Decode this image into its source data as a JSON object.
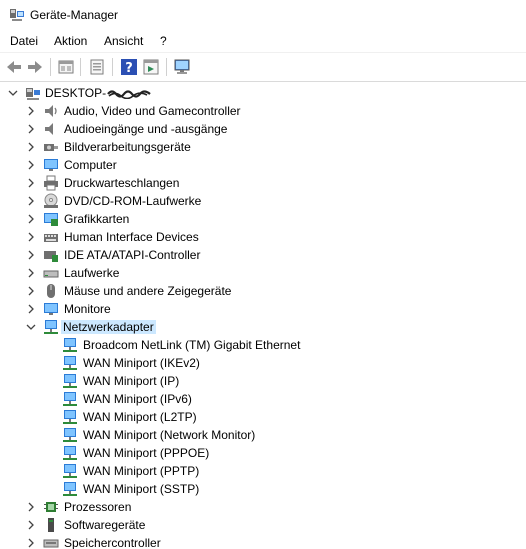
{
  "window": {
    "title": "Geräte-Manager"
  },
  "menu": [
    "Datei",
    "Aktion",
    "Ansicht",
    "?"
  ],
  "toolbar": [
    "back-icon",
    "forward-icon",
    "properties-icon",
    "update-icon",
    "help-icon",
    "show-hidden-icon",
    "monitor-scan-icon"
  ],
  "tree": {
    "root": "DESKTOP-",
    "categories": [
      "Audio, Video und Gamecontroller",
      "Audioeingänge und -ausgänge",
      "Bildverarbeitungsgeräte",
      "Computer",
      "Druckwarteschlangen",
      "DVD/CD-ROM-Laufwerke",
      "Grafikkarten",
      "Human Interface Devices",
      "IDE ATA/ATAPI-Controller",
      "Laufwerke",
      "Mäuse und andere Zeigegeräte",
      "Monitore",
      "Netzwerkadapter"
    ],
    "network_adapters": [
      "Broadcom NetLink (TM) Gigabit Ethernet",
      "WAN Miniport (IKEv2)",
      "WAN Miniport (IP)",
      "WAN Miniport (IPv6)",
      "WAN Miniport (L2TP)",
      "WAN Miniport (Network Monitor)",
      "WAN Miniport (PPPOE)",
      "WAN Miniport (PPTP)",
      "WAN Miniport (SSTP)"
    ],
    "after": [
      "Prozessoren",
      "Softwaregeräte",
      "Speichercontroller"
    ]
  }
}
